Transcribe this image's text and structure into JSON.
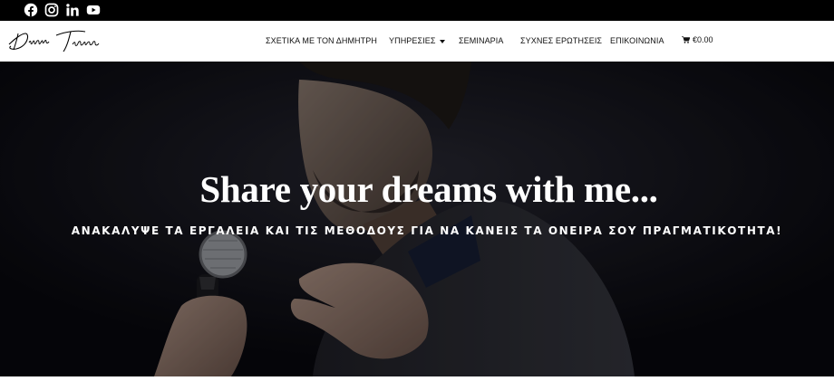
{
  "social": {
    "icons": [
      "facebook-icon",
      "instagram-icon",
      "linkedin-icon",
      "youtube-icon"
    ]
  },
  "logo": {
    "text": "Dimitris Tsolias"
  },
  "nav": {
    "about": "ΣΧΕΤΙΚΑ ΜΕ ΤΟΝ ΔΗΜΗΤΡΗ",
    "services": "ΥΠΗΡΕΣΙΕΣ",
    "seminars": "ΣΕΜΙΝΑΡΙΑ",
    "faq": "ΣΥΧΝΕΣ ΕΡΩΤΗΣΕΙΣ",
    "contact": "ΕΠΙΚΟΙΝΩΝΙΑ",
    "cart_total": "€0.00"
  },
  "hero": {
    "title": "Share your dreams with me...",
    "subtitle": "ΑΝΑΚΑΛΥΨΕ ΤΑ ΕΡΓΑΛΕΙΑ ΚΑΙ ΤΙΣ ΜΕΘΟΔΟΥΣ ΓΙΑ ΝΑ ΚΑΝΕΙΣ ΤΑ ΟΝΕΙΡΑ ΣΟΥ ΠΡΑΓΜΑΤΙΚΟΤΗΤΑ!"
  },
  "colors": {
    "topbar": "#000000",
    "header": "#ffffff",
    "hero_bg": "#07070c",
    "text_on_hero": "#ffffff"
  }
}
